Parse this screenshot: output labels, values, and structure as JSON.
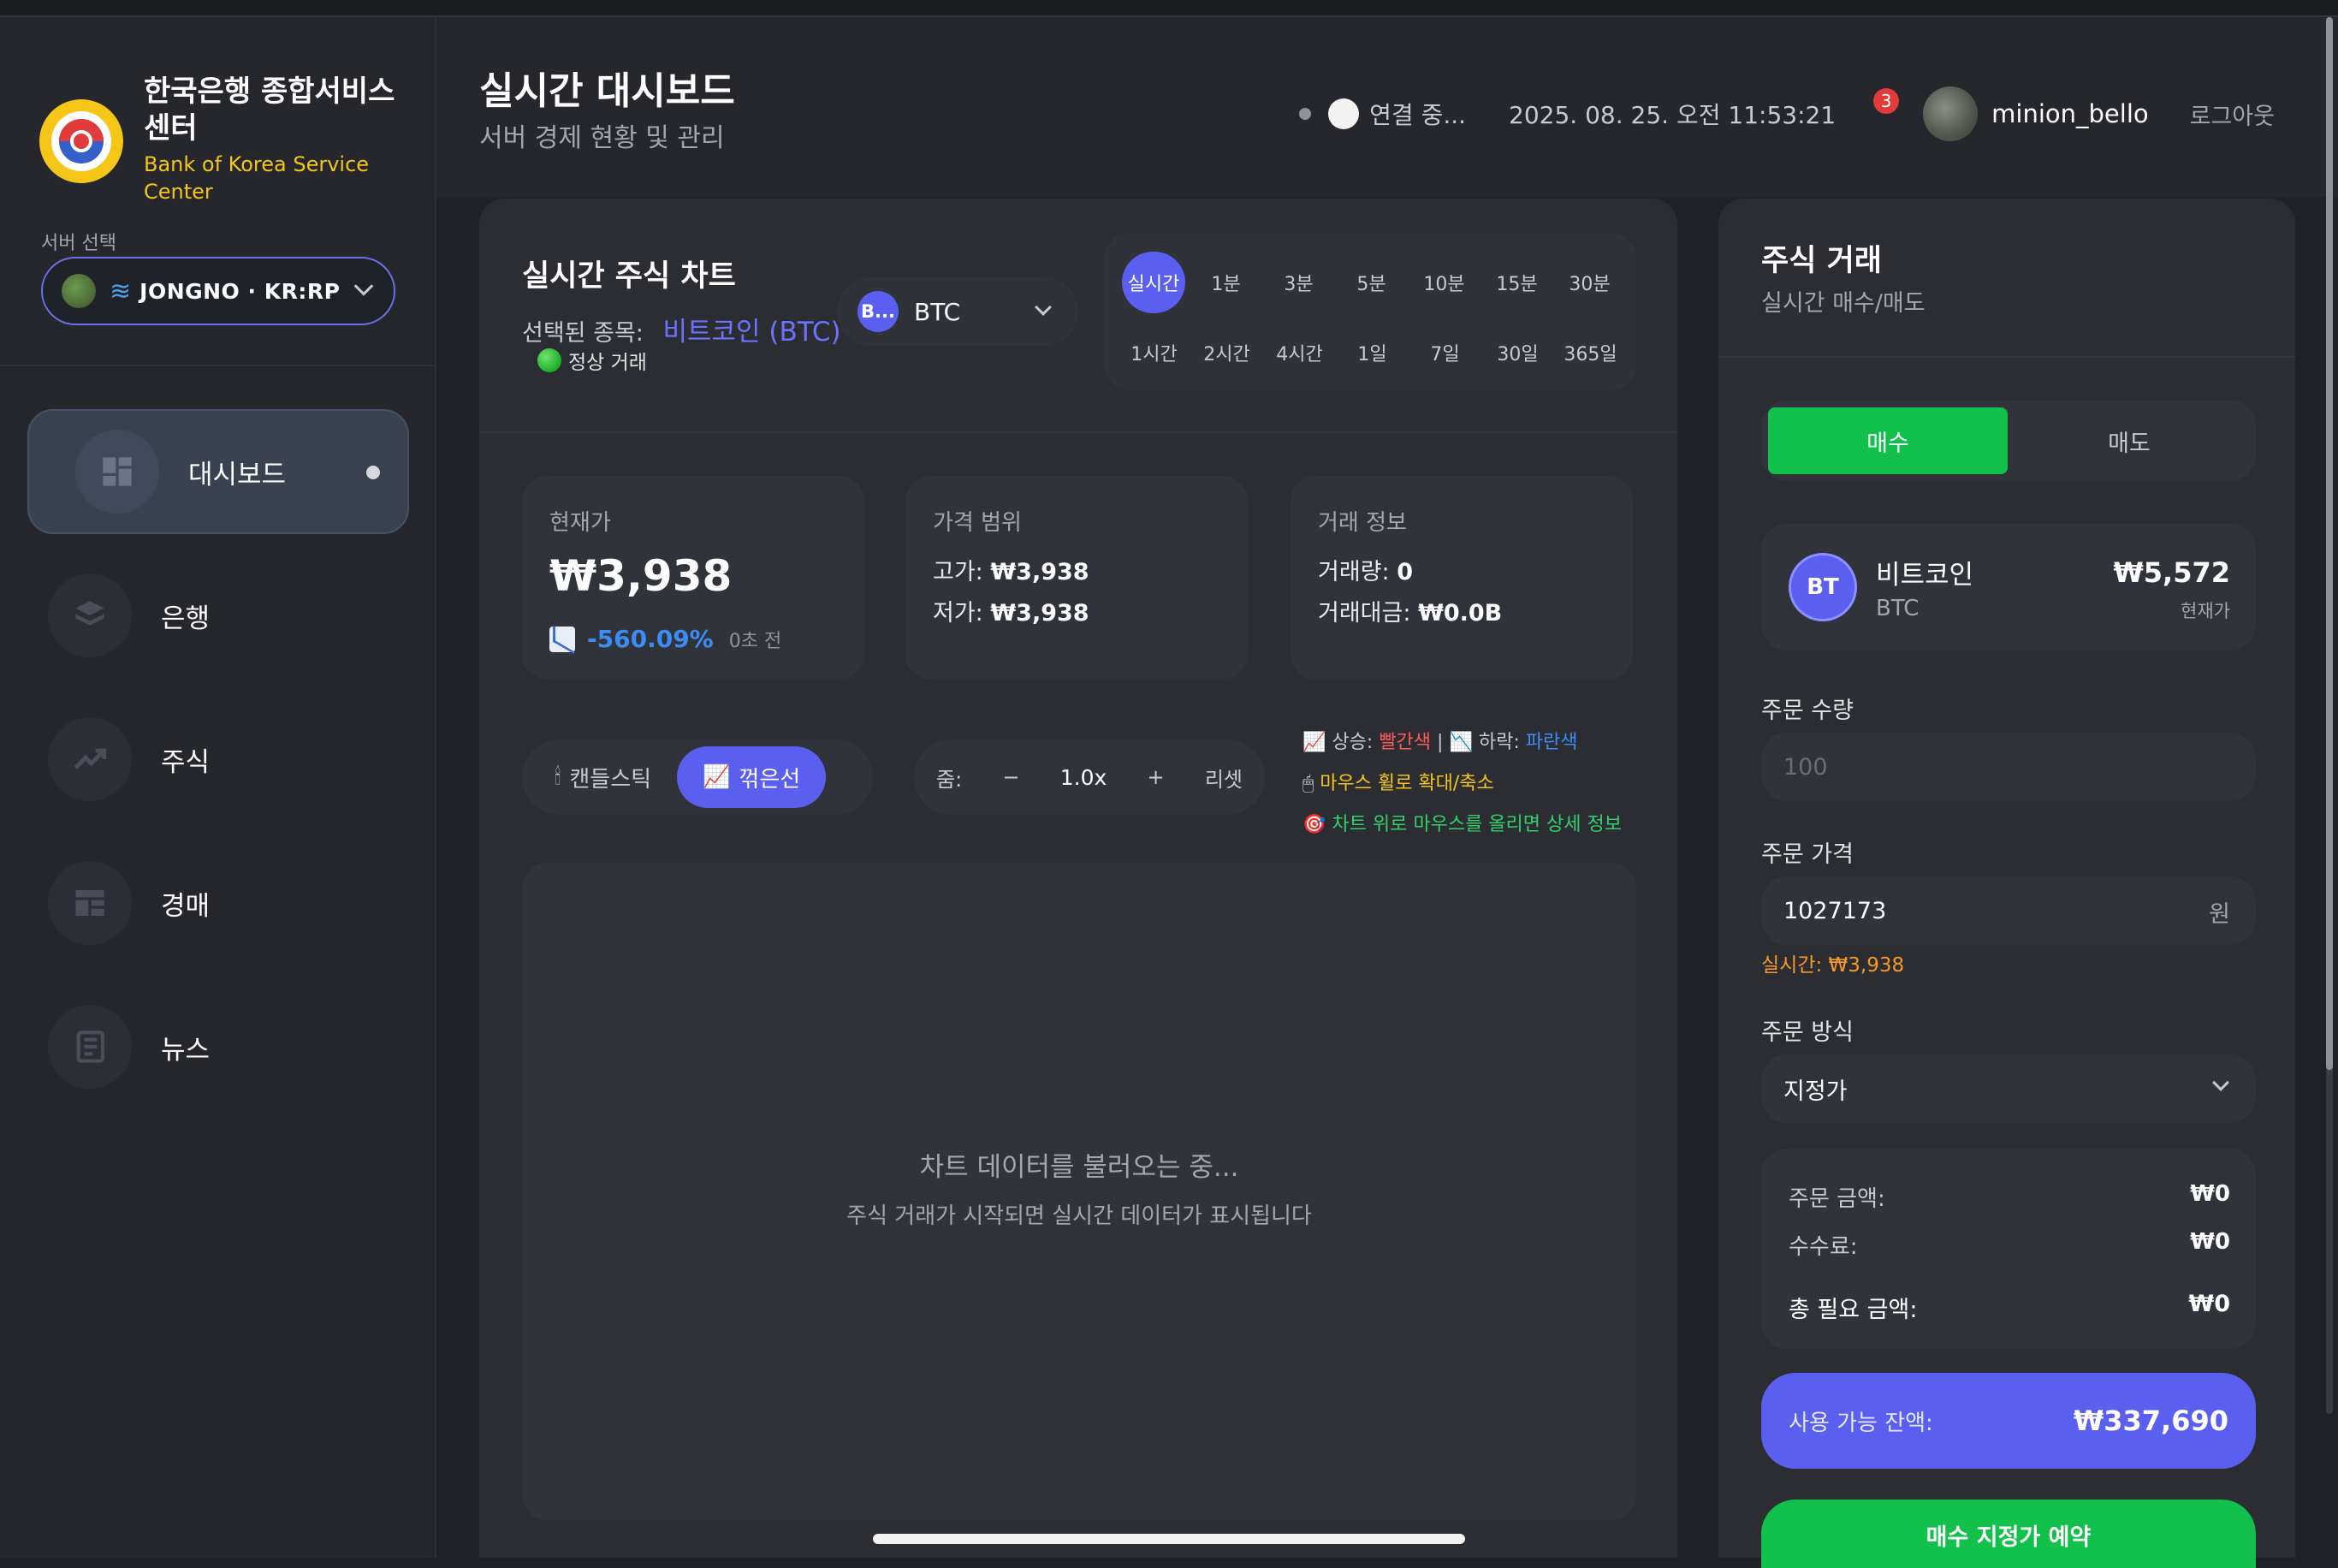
{
  "brand": {
    "title": "한국은행 종합서비스 센터",
    "subtitle": "Bank of Korea Service Center"
  },
  "server": {
    "label": "서버 선택",
    "selected": "JONGNO · KR:RP"
  },
  "nav": {
    "items": [
      {
        "label": "대시보드",
        "icon": "dashboard-icon",
        "active": true
      },
      {
        "label": "은행",
        "icon": "bank-icon"
      },
      {
        "label": "주식",
        "icon": "trending-up-icon"
      },
      {
        "label": "경매",
        "icon": "auction-icon"
      },
      {
        "label": "뉴스",
        "icon": "news-icon"
      }
    ]
  },
  "header": {
    "title": "실시간 대시보드",
    "subtitle": "서버 경제 현황 및 관리",
    "connection": "연결 중...",
    "datetime": "2025. 08. 25. 오전 11:53:21",
    "notifications": "3",
    "username": "minion_bello",
    "logout": "로그아웃"
  },
  "chart_panel": {
    "title": "실시간 주식 차트",
    "selected_label": "선택된 종목:",
    "selected_symbol": "비트코인 (BTC)",
    "status": "정상 거래",
    "symbol_badge": "B...",
    "symbol_text": "BTC",
    "timeframes_row1": [
      "실시간",
      "1분",
      "3분",
      "5분",
      "10분",
      "15분",
      "30분"
    ],
    "timeframes_row2": [
      "1시간",
      "2시간",
      "4시간",
      "1일",
      "7일",
      "30일",
      "365일"
    ],
    "active_timeframe": "실시간",
    "stats": {
      "current_label": "현재가",
      "current_price": "₩3,938",
      "change_pct": "-560.09%",
      "change_ago": "0초 전",
      "range_label": "가격 범위",
      "high_label": "고가:",
      "high": "₩3,938",
      "low_label": "저가:",
      "low": "₩3,938",
      "trade_label": "거래 정보",
      "volume_label": "거래량:",
      "volume": "0",
      "amount_label": "거래대금:",
      "amount": "₩0.0B"
    },
    "chart_types": {
      "candle": "캔들스틱",
      "line": "꺾은선",
      "active": "꺾은선"
    },
    "zoom": {
      "label": "줌:",
      "minus": "−",
      "value": "1.0x",
      "plus": "+",
      "reset": "리셋"
    },
    "legend": {
      "up_label": "상승:",
      "up_color_name": "빨간색",
      "sep": "|",
      "down_label": "하락:",
      "down_color_name": "파란색",
      "wheel": "마우스 휠로 확대/축소",
      "hover": "차트 위로 마우스를 올리면 상세 정보"
    },
    "loading_title": "차트 데이터를 불러오는 중...",
    "loading_sub": "주식 거래가 시작되면 실시간 데이터가 표시됩니다"
  },
  "trade_panel": {
    "title": "주식 거래",
    "subtitle": "실시간 매수/매도",
    "buy": "매수",
    "sell": "매도",
    "asset_badge": "BT",
    "asset_name": "비트코인",
    "asset_symbol": "BTC",
    "asset_price": "₩5,572",
    "asset_price_label": "현재가",
    "qty_label": "주문 수량",
    "qty_placeholder": "100",
    "price_label": "주문 가격",
    "price_value": "1027173",
    "price_unit": "원",
    "realtime": "실시간: ₩3,938",
    "method_label": "주문 방식",
    "method_value": "지정가",
    "summary": {
      "order_amount_label": "주문 금액:",
      "order_amount": "₩0",
      "fee_label": "수수료:",
      "fee": "₩0",
      "total_label": "총 필요 금액:",
      "total": "₩0"
    },
    "balance_label": "사용 가능 잔액:",
    "balance": "₩337,690",
    "order_button": "매수 지정가 예약"
  },
  "colors": {
    "accent": "#5b5ff0",
    "buy_green": "#12c14b",
    "up_red": "#ff5a5a",
    "down_blue": "#3b8cf5",
    "brand_yellow": "#f5c518"
  }
}
